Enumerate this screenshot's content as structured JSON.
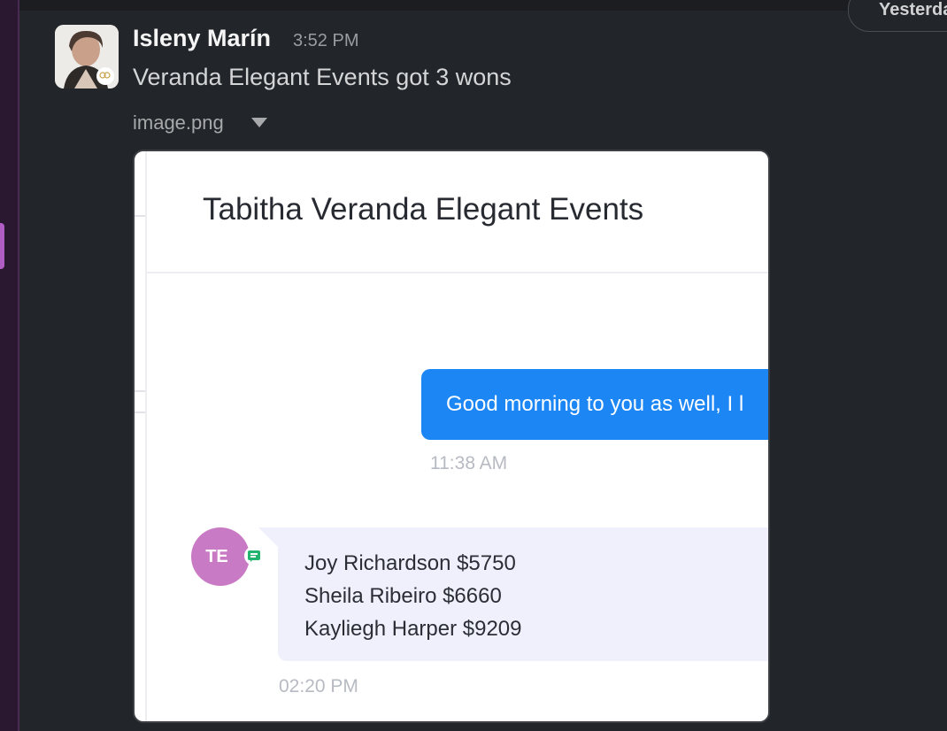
{
  "app": {
    "accent_color": "#b05ec4",
    "date_divider": "Yesterday"
  },
  "message": {
    "author": "Isleny Marín",
    "time": "3:52 PM",
    "text": "Veranda Elegant Events got 3 wons",
    "avatar_icon": "user-photo-avatar"
  },
  "attachment": {
    "file_name": "image.png",
    "toggle_icon": "caret-down-icon",
    "screenshot": {
      "title": "Tabitha Veranda Elegant Events",
      "sent_message": "Good morning to you as well, I l",
      "sent_time": "11:38 AM",
      "sender_initials": "TE",
      "badge_icon": "chat-bubble-icon",
      "received_lines": [
        "Joy Richardson $5750",
        "Sheila Ribeiro $6660",
        "Kayliegh Harper $9209"
      ],
      "received_time": "02:20 PM",
      "sent_bubble_color": "#1c86f5",
      "avatar_color": "#c97ac4"
    }
  }
}
